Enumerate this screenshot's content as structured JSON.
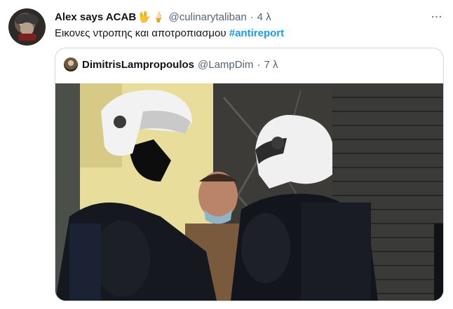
{
  "tweet": {
    "author_name": "Alex says ACAB",
    "emoji_1": "🖖",
    "emoji_2": "🍦",
    "handle": "@culinarytaliban",
    "separator": "·",
    "time": "4 λ",
    "more": "⋯",
    "text": "Εικονες ντροπης και αποτροπιασμου",
    "hashtag": "#antireport"
  },
  "quoted_tweet": {
    "author_name": "DimitrisLampropoulos",
    "handle": "@LampDim",
    "separator": "·",
    "time": "7 λ",
    "image": "photo of two riot police officers in white helmets confronting a man"
  },
  "colors": {
    "link": "#1d9bf0",
    "secondary_text": "#536471",
    "border": "#cfd9de"
  }
}
